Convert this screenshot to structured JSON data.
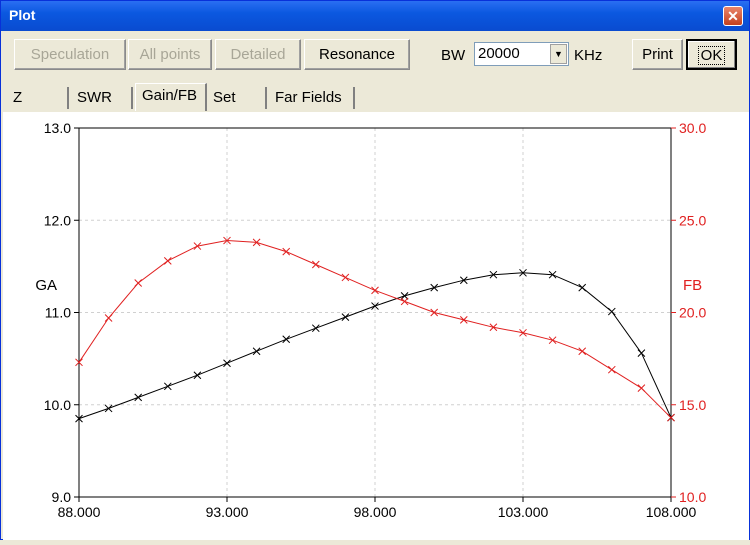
{
  "window": {
    "title": "Plot",
    "close_label": "✕"
  },
  "toolbar": {
    "speculation": "Speculation",
    "all_points": "All points",
    "detailed": "Detailed",
    "resonance": "Resonance",
    "bw_label": "BW",
    "bw_value": "20000",
    "unit": "KHz",
    "print": "Print",
    "ok": "OK"
  },
  "tabs": [
    "Z",
    "SWR",
    "Gain/FB",
    "Set",
    "Far Fields"
  ],
  "active_tab": "Gain/FB",
  "colors": {
    "ga": "#000000",
    "fb": "#e02020",
    "grid": "#d0d0d0"
  },
  "chart_data": {
    "type": "line",
    "xlabel": "",
    "x_ticks": [
      "88.000",
      "93.000",
      "98.000",
      "103.000",
      "108.000"
    ],
    "xlim": [
      88,
      108
    ],
    "left_axis": {
      "label": "GA",
      "ylim": [
        9.0,
        13.0
      ],
      "ticks": [
        "9.0",
        "10.0",
        "11.0",
        "12.0",
        "13.0"
      ]
    },
    "right_axis": {
      "label": "FB",
      "ylim": [
        10.0,
        30.0
      ],
      "ticks": [
        "10.0",
        "15.0",
        "20.0",
        "25.0",
        "30.0"
      ]
    },
    "grid": true,
    "series": [
      {
        "name": "GA",
        "axis": "left",
        "x": [
          88,
          89,
          90,
          91,
          92,
          93,
          94,
          95,
          96,
          97,
          98,
          99,
          100,
          101,
          102,
          103,
          104,
          105,
          106,
          107,
          108
        ],
        "y": [
          9.85,
          9.96,
          10.08,
          10.2,
          10.32,
          10.45,
          10.58,
          10.71,
          10.83,
          10.95,
          11.07,
          11.18,
          11.27,
          11.35,
          11.41,
          11.43,
          11.41,
          11.27,
          11.01,
          10.56,
          9.86
        ]
      },
      {
        "name": "FB",
        "axis": "right",
        "x": [
          88,
          89,
          90,
          91,
          92,
          93,
          94,
          95,
          96,
          97,
          98,
          99,
          100,
          101,
          102,
          103,
          104,
          105,
          106,
          107,
          108
        ],
        "y": [
          17.3,
          19.7,
          21.6,
          22.8,
          23.6,
          23.9,
          23.8,
          23.3,
          22.6,
          21.9,
          21.2,
          20.6,
          20.0,
          19.6,
          19.2,
          18.9,
          18.5,
          17.9,
          16.9,
          15.9,
          14.3
        ]
      }
    ]
  }
}
